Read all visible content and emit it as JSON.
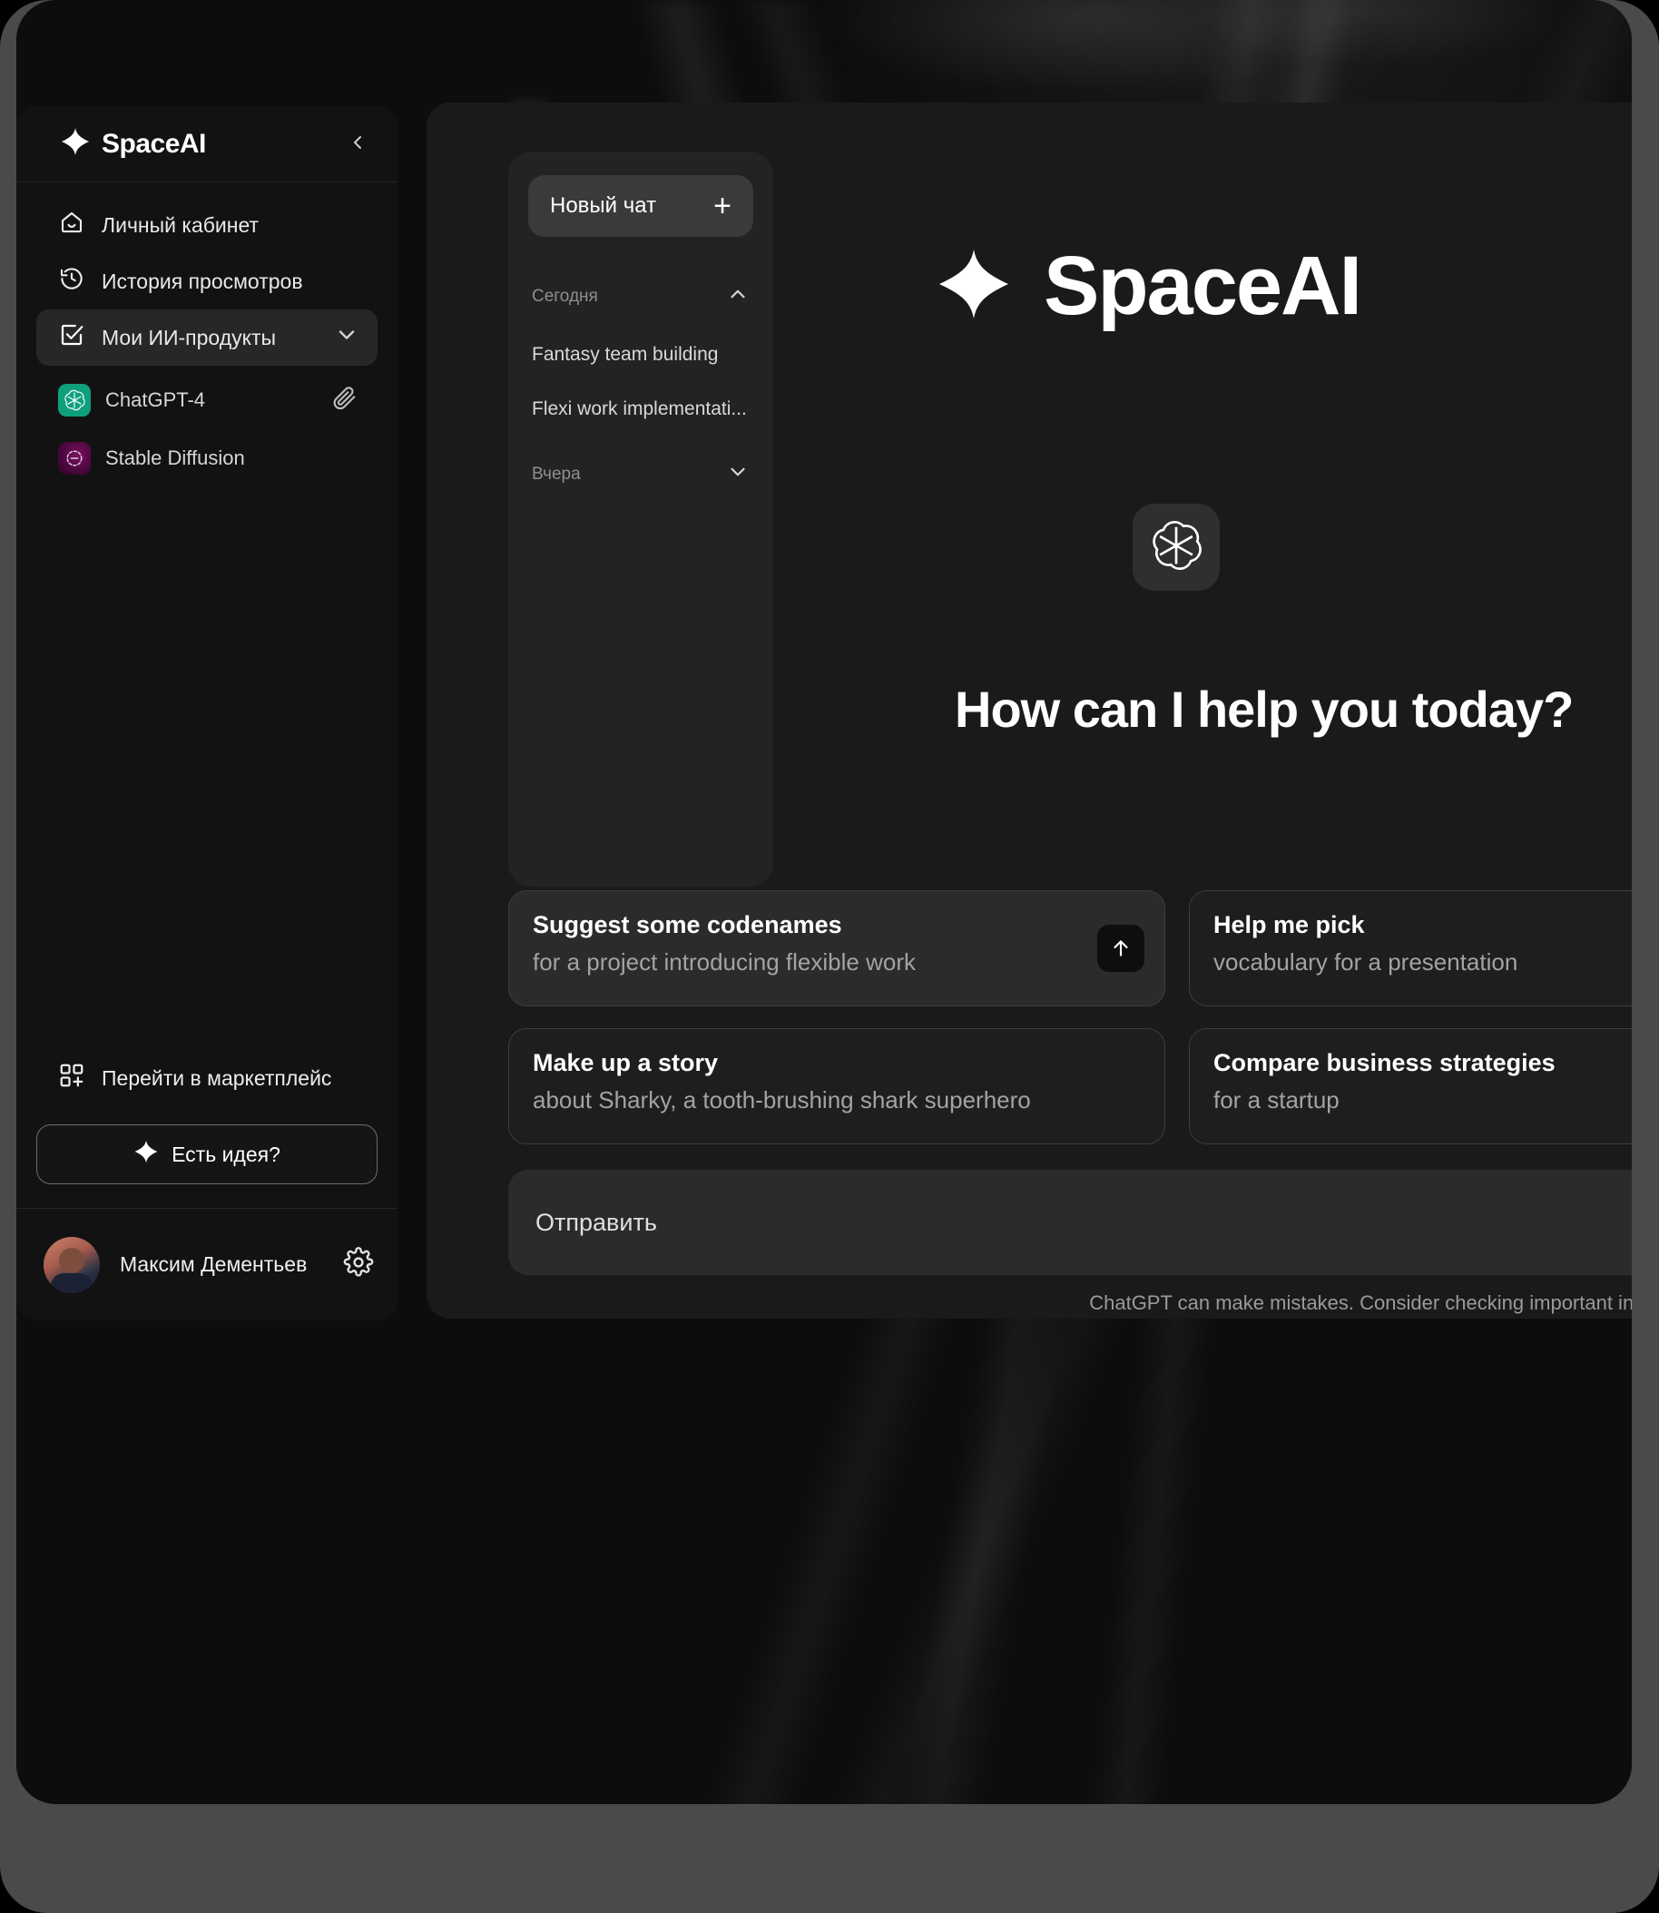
{
  "app": {
    "brand": "SpaceAI",
    "collapse_icon": "chevron-left-icon",
    "logo_icon": "sparkle-icon"
  },
  "sidebar": {
    "nav": [
      {
        "label": "Личный кабинет",
        "icon": "home-icon",
        "active": false,
        "chevron": ""
      },
      {
        "label": "История просмотров",
        "icon": "history-clock-icon",
        "active": false,
        "chevron": ""
      },
      {
        "label": "Мои ИИ-продукты",
        "icon": "checkbox-check-icon",
        "active": true,
        "chevron": "chevron-down-icon"
      }
    ],
    "products": [
      {
        "label": "ChatGPT-4",
        "icon": "openai-icon",
        "trailing_icon": "paperclip-icon",
        "color": "#0f9f7e"
      },
      {
        "label": "Stable Diffusion",
        "icon": "stable-diffusion-icon",
        "trailing_icon": "",
        "color": "#7d1060"
      }
    ],
    "marketplace": {
      "label": "Перейти в маркетплейс",
      "icon": "grid-plus-icon"
    },
    "idea_button": {
      "label": "Есть идея?",
      "icon": "sparkle-icon"
    },
    "user": {
      "name": "Максим Дементьев",
      "avatar": "user-avatar",
      "settings_icon": "gear-icon"
    }
  },
  "chats": {
    "new_chat": {
      "label": "Новый чат",
      "icon": "plus-icon"
    },
    "groups": [
      {
        "label": "Сегодня",
        "chevron": "chevron-up-icon",
        "expanded": true,
        "items": [
          "Fantasy team building",
          "Flexi work implementati..."
        ]
      },
      {
        "label": "Вчера",
        "chevron": "chevron-down-icon",
        "expanded": false,
        "items": []
      }
    ]
  },
  "main": {
    "hero_brand": "SpaceAI",
    "hero_icon": "sparkle-icon",
    "assistant_icon": "openai-icon",
    "greeting": "How can I help you today?",
    "cards": [
      {
        "title": "Suggest some codenames",
        "subtitle": "for a project introducing flexible work",
        "highlighted": true,
        "send_icon": "arrow-up-icon"
      },
      {
        "title": "Help me pick",
        "subtitle": "vocabulary for a presentation",
        "highlighted": false,
        "send_icon": ""
      },
      {
        "title": "Make up a story",
        "subtitle": "about Sharky, a tooth-brushing shark superhero",
        "highlighted": false,
        "send_icon": ""
      },
      {
        "title": "Compare business strategies",
        "subtitle": "for a startup",
        "highlighted": false,
        "send_icon": ""
      }
    ],
    "composer_placeholder": "Отправить",
    "disclaimer": "ChatGPT can make mistakes. Consider checking important information."
  },
  "colors": {
    "accent_green": "#0f9f7e",
    "accent_purple": "#7d1060",
    "panel": "#1a1a1a",
    "sidebar": "#121212",
    "card": "#2b2b2b"
  }
}
